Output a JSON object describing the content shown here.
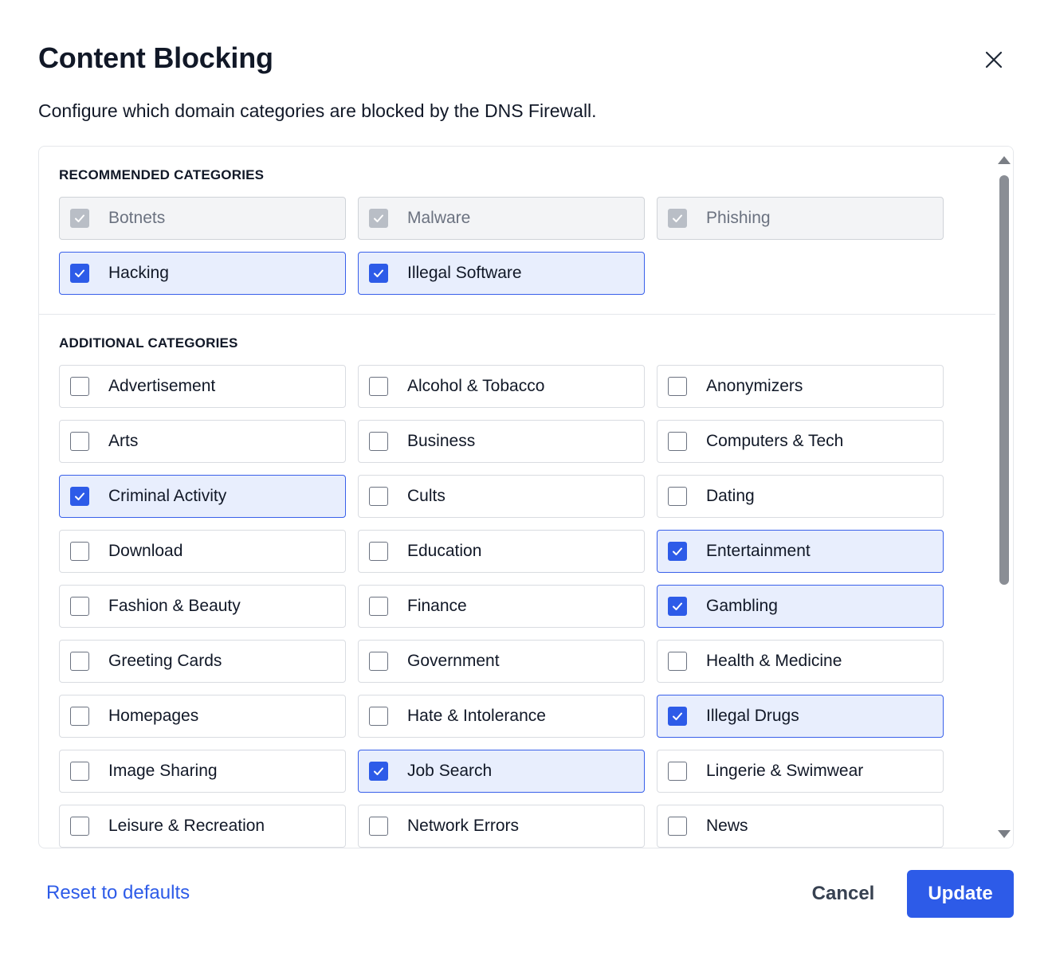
{
  "dialog": {
    "title": "Content Blocking",
    "subtitle": "Configure which domain categories are blocked by the DNS Firewall."
  },
  "recommended": {
    "label": "RECOMMENDED CATEGORIES",
    "items": [
      {
        "label": "Botnets",
        "state": "locked-checked"
      },
      {
        "label": "Malware",
        "state": "locked-checked"
      },
      {
        "label": "Phishing",
        "state": "locked-checked"
      },
      {
        "label": "Hacking",
        "state": "checked"
      },
      {
        "label": "Illegal Software",
        "state": "checked"
      }
    ]
  },
  "additional": {
    "label": "ADDITIONAL CATEGORIES",
    "items": [
      {
        "label": "Advertisement",
        "state": "unchecked"
      },
      {
        "label": "Alcohol & Tobacco",
        "state": "unchecked"
      },
      {
        "label": "Anonymizers",
        "state": "unchecked"
      },
      {
        "label": "Arts",
        "state": "unchecked"
      },
      {
        "label": "Business",
        "state": "unchecked"
      },
      {
        "label": "Computers & Tech",
        "state": "unchecked"
      },
      {
        "label": "Criminal Activity",
        "state": "checked"
      },
      {
        "label": "Cults",
        "state": "unchecked"
      },
      {
        "label": "Dating",
        "state": "unchecked"
      },
      {
        "label": "Download",
        "state": "unchecked"
      },
      {
        "label": "Education",
        "state": "unchecked"
      },
      {
        "label": "Entertainment",
        "state": "checked"
      },
      {
        "label": "Fashion & Beauty",
        "state": "unchecked"
      },
      {
        "label": "Finance",
        "state": "unchecked"
      },
      {
        "label": "Gambling",
        "state": "checked"
      },
      {
        "label": "Greeting Cards",
        "state": "unchecked"
      },
      {
        "label": "Government",
        "state": "unchecked"
      },
      {
        "label": "Health & Medicine",
        "state": "unchecked"
      },
      {
        "label": "Homepages",
        "state": "unchecked"
      },
      {
        "label": "Hate & Intolerance",
        "state": "unchecked"
      },
      {
        "label": "Illegal Drugs",
        "state": "checked"
      },
      {
        "label": "Image Sharing",
        "state": "unchecked"
      },
      {
        "label": "Job Search",
        "state": "checked"
      },
      {
        "label": "Lingerie & Swimwear",
        "state": "unchecked"
      },
      {
        "label": "Leisure & Recreation",
        "state": "unchecked"
      },
      {
        "label": "Network Errors",
        "state": "unchecked"
      },
      {
        "label": "News",
        "state": "unchecked"
      }
    ]
  },
  "footer": {
    "reset_label": "Reset to defaults",
    "cancel_label": "Cancel",
    "update_label": "Update"
  },
  "colors": {
    "accent": "#2d5be8",
    "checked_bg": "#e8eefd",
    "locked_bg": "#f3f4f6",
    "text": "#111827"
  },
  "icons": {
    "close": "close-icon",
    "check": "checkmark-icon"
  }
}
